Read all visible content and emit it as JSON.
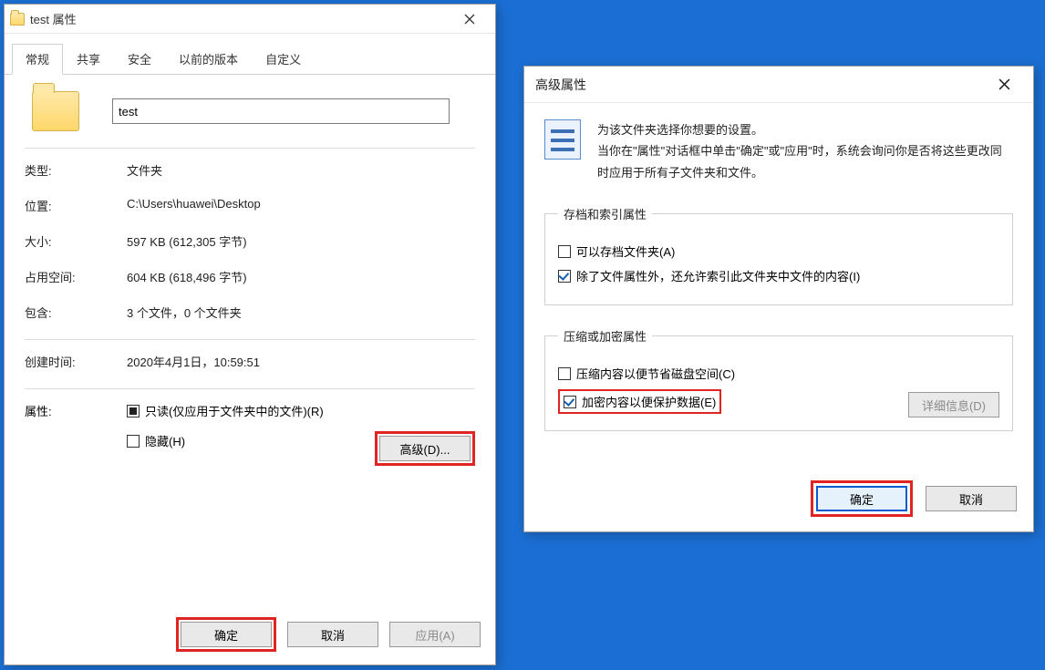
{
  "props": {
    "window_title": "test 属性",
    "tabs": [
      "常规",
      "共享",
      "安全",
      "以前的版本",
      "自定义"
    ],
    "name_value": "test",
    "rows": {
      "type_k": "类型:",
      "type_v": "文件夹",
      "loc_k": "位置:",
      "loc_v": "C:\\Users\\huawei\\Desktop",
      "size_k": "大小:",
      "size_v": "597 KB (612,305 字节)",
      "disk_k": "占用空间:",
      "disk_v": "604 KB (618,496 字节)",
      "contains_k": "包含:",
      "contains_v": "3 个文件，0 个文件夹",
      "created_k": "创建时间:",
      "created_v": "2020年4月1日，10:59:51",
      "attr_k": "属性:"
    },
    "readonly_label": "只读(仅应用于文件夹中的文件)(R)",
    "hidden_label": "隐藏(H)",
    "advanced_btn": "高级(D)...",
    "ok": "确定",
    "cancel": "取消",
    "apply": "应用(A)"
  },
  "adv": {
    "title": "高级属性",
    "intro1": "为该文件夹选择你想要的设置。",
    "intro2": "当你在\"属性\"对话框中单击\"确定\"或\"应用\"时，系统会询问你是否将这些更改同时应用于所有子文件夹和文件。",
    "group1_title": "存档和索引属性",
    "archive_label": "可以存档文件夹(A)",
    "index_label": "除了文件属性外，还允许索引此文件夹中文件的内容(I)",
    "group2_title": "压缩或加密属性",
    "compress_label": "压缩内容以便节省磁盘空间(C)",
    "encrypt_label": "加密内容以便保护数据(E)",
    "details_btn": "详细信息(D)",
    "ok": "确定",
    "cancel": "取消"
  }
}
